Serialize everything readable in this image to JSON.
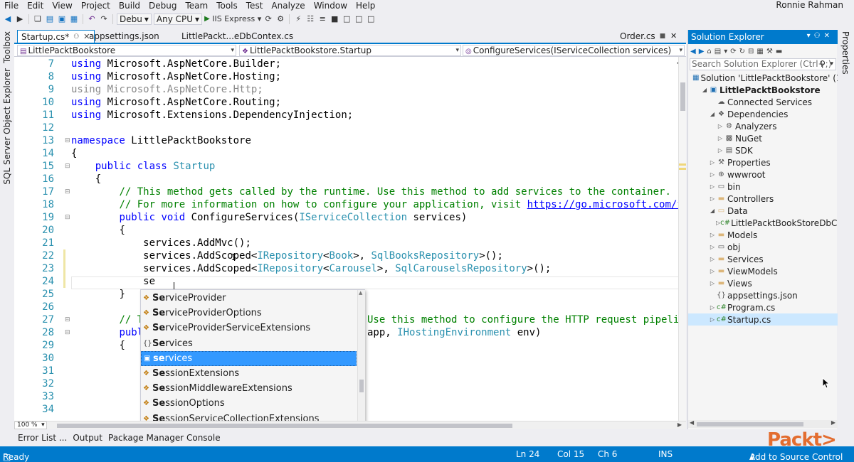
{
  "menu": [
    "File",
    "Edit",
    "View",
    "Project",
    "Build",
    "Debug",
    "Team",
    "Tools",
    "Test",
    "Analyze",
    "Window",
    "Help"
  ],
  "user_name": "Ronnie Rahman",
  "toolbar": {
    "config": "Debu",
    "platform": "Any CPU",
    "run_target": "IIS Express"
  },
  "left_tabs": [
    "Toolbox",
    "SQL Server Object Explorer"
  ],
  "right_tabs": [
    "Properties"
  ],
  "tabs": {
    "startup": "Startup.cs*",
    "appsettings": "appsettings.json",
    "dbcontext": "LittlePackt...eDbContex.cs",
    "order": "Order.cs"
  },
  "nav": {
    "project": "LittlePacktBookstore",
    "class": "LittlePacktBookstore.Startup",
    "member": "ConfigureServices(IServiceCollection services)"
  },
  "code": {
    "line_numbers": [
      "7",
      "8",
      "9",
      "10",
      "11",
      "12",
      "13",
      "14",
      "15",
      "16",
      "17",
      "18",
      "19",
      "20",
      "21",
      "22",
      "23",
      "24",
      "25",
      "26",
      "27",
      "28",
      "29",
      "30",
      "31",
      "32",
      "33",
      "34"
    ],
    "using_kw": "using",
    "ns1": "Microsoft.AspNetCore.Builder;",
    "ns2": "Microsoft.AspNetCore.Hosting;",
    "ns3": "Microsoft.AspNetCore.Http;",
    "ns4": "Microsoft.AspNetCore.Routing;",
    "ns5": "Microsoft.Extensions.DependencyInjection;",
    "namespace_kw": "namespace",
    "namespace_name": "LittlePacktBookstore",
    "brace_open": "{",
    "brace_close": "}",
    "public_class": "public class",
    "class_name": "Startup",
    "comment1": "// This method gets called by the runtime. Use this method to add services to the container.",
    "comment2a": "// For more information on how to configure your application, visit ",
    "comment2b": "https://go.microsoft.com/fwli",
    "public_void": "public void",
    "method_name": "ConfigureServices(",
    "param_type": "IServiceCollection",
    "param_name": " services)",
    "addmvc": "services.AddMvc();",
    "addscoped": "services.AddScoped<",
    "irepo": "IRepository",
    "lt": "<",
    "book": "Book",
    "sqlbooks": "SqlBooksRepository",
    "carousel": "Carousel",
    "sqlcarousels": "SqlCarouselsRepository",
    "generic_tail": ">, ",
    "end_call": ">();",
    "typing": "se",
    "comment3_start": "// T",
    "comment3_end": "Use this method to configure the HTTP request pipeline",
    "publ": "publ",
    "app_param": "app, ",
    "ihost": "IHostingEnvironment",
    "env": " env)"
  },
  "intellisense": {
    "items": [
      {
        "match": "Se",
        "rest": "rviceProvider",
        "icon": "class"
      },
      {
        "match": "Se",
        "rest": "rviceProviderOptions",
        "icon": "class"
      },
      {
        "match": "Se",
        "rest": "rviceProviderServiceExtensions",
        "icon": "class"
      },
      {
        "match": "Se",
        "rest": "rvices",
        "icon": "namespace"
      },
      {
        "match": "se",
        "rest": "rvices",
        "icon": "variable"
      },
      {
        "match": "Se",
        "rest": "ssionExtensions",
        "icon": "class"
      },
      {
        "match": "Se",
        "rest": "ssionMiddlewareExtensions",
        "icon": "class"
      },
      {
        "match": "Se",
        "rest": "ssionOptions",
        "icon": "class"
      },
      {
        "match": "Se",
        "rest": "ssionServiceCollectionExtensions",
        "icon": "class"
      }
    ],
    "selected_index": 4
  },
  "zoom": "100 %",
  "bottom_tabs": [
    "Error List ...",
    "Output",
    "Package Manager Console"
  ],
  "solution_explorer": {
    "title": "Solution Explorer",
    "search_placeholder": "Search Solution Explorer (Ctrl+;)",
    "tree": [
      {
        "label": "Solution 'LittlePacktBookstore' (1 pr",
        "indent": 0,
        "expander": "",
        "icon": "sln"
      },
      {
        "label": "LittlePacktBookstore",
        "indent": 1,
        "expander": "open",
        "icon": "proj",
        "bold": true
      },
      {
        "label": "Connected Services",
        "indent": 2,
        "expander": "",
        "icon": "svc"
      },
      {
        "label": "Dependencies",
        "indent": 2,
        "expander": "open",
        "icon": "dep"
      },
      {
        "label": "Analyzers",
        "indent": 3,
        "expander": "closed",
        "icon": "an"
      },
      {
        "label": "NuGet",
        "indent": 3,
        "expander": "closed",
        "icon": "nuget"
      },
      {
        "label": "SDK",
        "indent": 3,
        "expander": "closed",
        "icon": "sdk"
      },
      {
        "label": "Properties",
        "indent": 2,
        "expander": "closed",
        "icon": "wrench"
      },
      {
        "label": "wwwroot",
        "indent": 2,
        "expander": "closed",
        "icon": "globe"
      },
      {
        "label": "bin",
        "indent": 2,
        "expander": "closed",
        "icon": "folder-outline"
      },
      {
        "label": "Controllers",
        "indent": 2,
        "expander": "closed",
        "icon": "folder"
      },
      {
        "label": "Data",
        "indent": 2,
        "expander": "open",
        "icon": "folder-open"
      },
      {
        "label": "LittlePacktBookStoreDbConte",
        "indent": 3,
        "expander": "closed",
        "icon": "cs"
      },
      {
        "label": "Models",
        "indent": 2,
        "expander": "closed",
        "icon": "folder"
      },
      {
        "label": "obj",
        "indent": 2,
        "expander": "closed",
        "icon": "folder-outline"
      },
      {
        "label": "Services",
        "indent": 2,
        "expander": "closed",
        "icon": "folder"
      },
      {
        "label": "ViewModels",
        "indent": 2,
        "expander": "closed",
        "icon": "folder"
      },
      {
        "label": "Views",
        "indent": 2,
        "expander": "closed",
        "icon": "folder"
      },
      {
        "label": "appsettings.json",
        "indent": 2,
        "expander": "",
        "icon": "json"
      },
      {
        "label": "Program.cs",
        "indent": 2,
        "expander": "closed",
        "icon": "cs"
      },
      {
        "label": "Startup.cs",
        "indent": 2,
        "expander": "closed",
        "icon": "cs",
        "selected": true
      }
    ]
  },
  "status": {
    "ready": "Ready",
    "ln": "Ln 24",
    "col": "Col 15",
    "ch": "Ch 6",
    "ins": "INS",
    "source_control": "Add to Source Control"
  },
  "watermark": "Packt>",
  "colors": {
    "accent": "#007acc",
    "selection": "#3399ff",
    "keyword": "#0000ff",
    "type": "#2b91af",
    "comment": "#008000"
  }
}
